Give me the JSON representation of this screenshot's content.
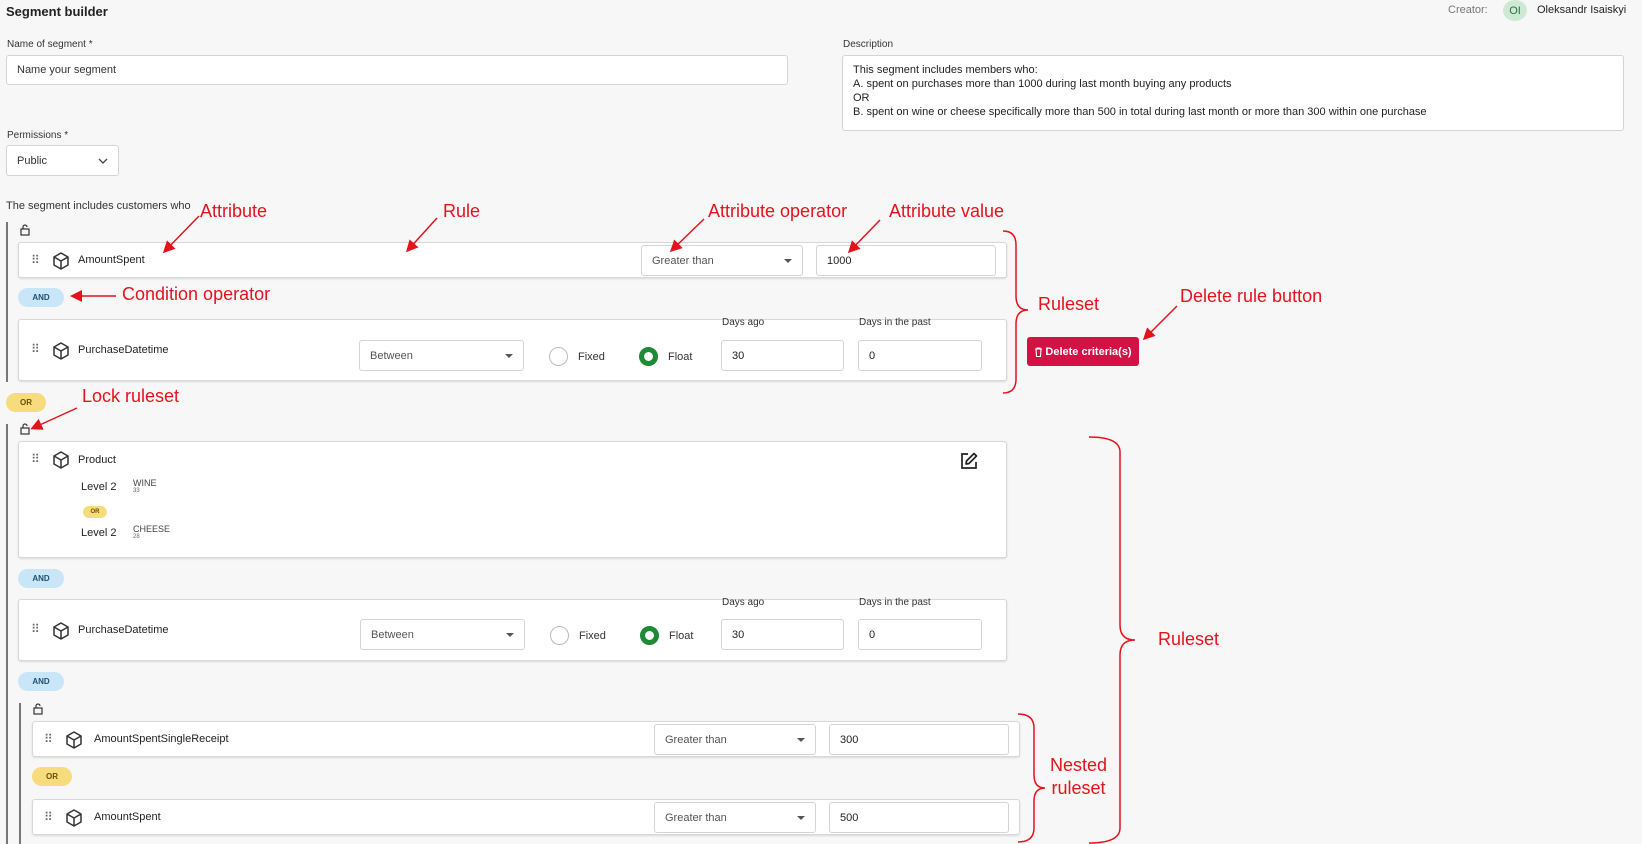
{
  "header": {
    "title": "Segment builder",
    "creator_label": "Creator:",
    "creator_initials": "OI",
    "creator_name": "Oleksandr Isaiskyi"
  },
  "form": {
    "name_label": "Name of segment *",
    "name_placeholder": "Name your segment",
    "description_label": "Description",
    "description_value": "This segment includes members who:\nA. spent on purchases more than 1000 during last month buying any products\nOR\nB. spent on wine or cheese specifically more than 500 in total during last month or more than 300 within one purchase",
    "permissions_label": "Permissions *",
    "permissions_value": "Public"
  },
  "intro_text": "The segment includes customers who",
  "ruleset1": {
    "rule1": {
      "attribute": "AmountSpent",
      "operator": "Greater than",
      "value": "1000"
    },
    "condition": "AND",
    "rule2": {
      "attribute": "PurchaseDatetime",
      "operator": "Between",
      "fixed_label": "Fixed",
      "float_label": "Float",
      "days_ago_label": "Days ago",
      "days_ago_value": "30",
      "days_past_label": "Days in the past",
      "days_past_value": "0"
    }
  },
  "or_between": "OR",
  "ruleset2": {
    "product": {
      "attribute": "Product",
      "level1_label": "Level 2",
      "level1_name": "WINE",
      "level1_count": "33",
      "or": "OR",
      "level2_label": "Level 2",
      "level2_name": "CHEESE",
      "level2_count": "28"
    },
    "cond1": "AND",
    "rule2": {
      "attribute": "PurchaseDatetime",
      "operator": "Between",
      "fixed_label": "Fixed",
      "float_label": "Float",
      "days_ago_label": "Days ago",
      "days_ago_value": "30",
      "days_past_label": "Days in the past",
      "days_past_value": "0"
    },
    "cond2": "AND",
    "nested": {
      "rule1": {
        "attribute": "AmountSpentSingleReceipt",
        "operator": "Greater than",
        "value": "300"
      },
      "condition": "OR",
      "rule2": {
        "attribute": "AmountSpent",
        "operator": "Greater than",
        "value": "500"
      }
    }
  },
  "delete_button": "Delete criteria(s)",
  "annotations": {
    "attribute": "Attribute",
    "rule": "Rule",
    "attribute_operator": "Attribute operator",
    "attribute_value": "Attribute value",
    "condition_operator": "Condition operator",
    "ruleset1": "Ruleset",
    "delete_rule_button": "Delete rule button",
    "lock_ruleset": "Lock ruleset",
    "ruleset2": "Ruleset",
    "nested_ruleset": "Nested\nruleset"
  },
  "colors": {
    "annotation": "#e5121c",
    "delete_button": "#d31145",
    "radio_checked": "#1e8a35",
    "and_pill": "#c8e6f7",
    "or_pill": "#f7dc7d"
  },
  "icons": [
    "cube-icon",
    "drag-handle-icon",
    "lock-icon",
    "edit-icon",
    "trash-icon",
    "chevron-down-icon"
  ]
}
